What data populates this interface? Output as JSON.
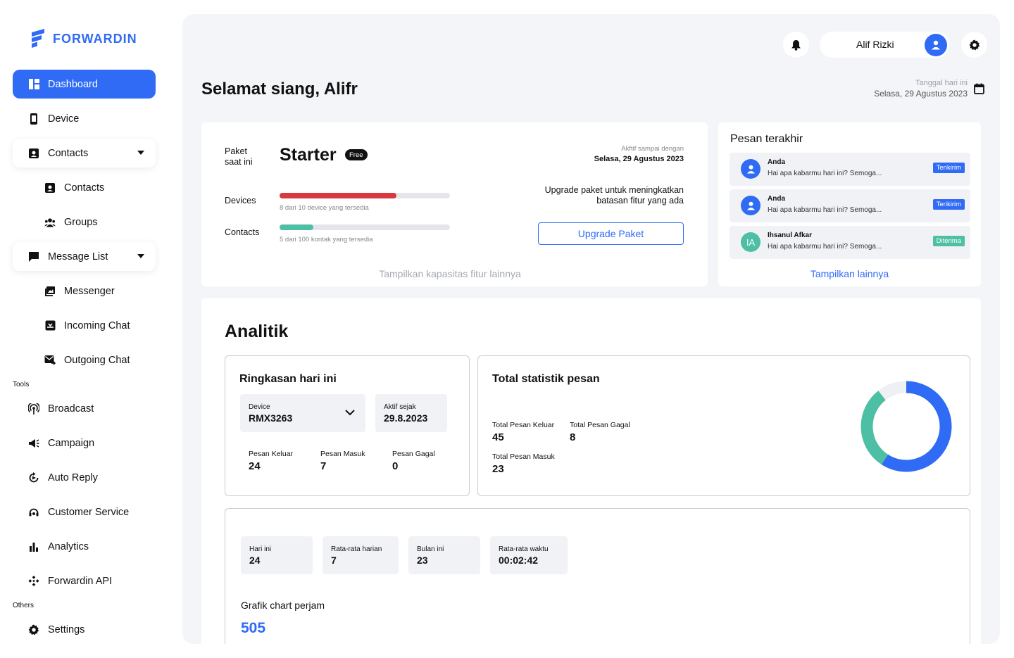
{
  "brand": {
    "name": "FORWARDIN",
    "color": "#2f6bf5"
  },
  "sidebar": {
    "items": [
      {
        "label": "Dashboard",
        "icon": "dashboard-icon"
      },
      {
        "label": "Device",
        "icon": "phone-icon"
      },
      {
        "label": "Contacts",
        "icon": "contact-card-icon"
      },
      {
        "label": "Contacts",
        "icon": "contact-card-icon"
      },
      {
        "label": "Groups",
        "icon": "groups-icon"
      },
      {
        "label": "Message List",
        "icon": "message-icon"
      },
      {
        "label": "Messenger",
        "icon": "messenger-icon"
      },
      {
        "label": "Incoming Chat",
        "icon": "inbox-icon"
      },
      {
        "label": "Outgoing Chat",
        "icon": "outbox-icon"
      },
      {
        "label": "Broadcast",
        "icon": "broadcast-icon"
      },
      {
        "label": "Campaign",
        "icon": "megaphone-icon"
      },
      {
        "label": "Auto Reply",
        "icon": "auto-reply-icon"
      },
      {
        "label": "Customer Service",
        "icon": "headset-icon"
      },
      {
        "label": "Analytics",
        "icon": "bar-chart-icon"
      },
      {
        "label": "Forwardin API",
        "icon": "api-icon"
      },
      {
        "label": "Settings",
        "icon": "gear-icon"
      }
    ],
    "section_tools": "Tools",
    "section_others": "Others"
  },
  "header": {
    "user_name": "Alif Rizki"
  },
  "greeting": "Selamat siang, Alifr",
  "date": {
    "label": "Tanggal hari ini",
    "value": "Selasa, 29 Agustus 2023"
  },
  "paket": {
    "label": "Paket saat ini",
    "plan": "Starter",
    "badge": "Free",
    "active_label": "Akftif sampai dengan",
    "active_date": "Selasa, 29 Agustus 2023",
    "devices_label": "Devices",
    "devices_hint": "8 dari 10 device yang tersedia",
    "devices_used": 8,
    "devices_total": 10,
    "contacts_label": "Contacts",
    "contacts_hint": "5 dari 100 kontak yang tersedia",
    "contacts_used": 5,
    "contacts_total": 100,
    "upgrade_text": "Upgrade paket untuk meningkatkan batasan fitur yang ada",
    "upgrade_button": "Upgrade Paket",
    "more_link": "Tampilkan kapasitas fitur lainnya",
    "devices_color": "#d7393f",
    "contacts_color": "#4dbfa4"
  },
  "messages": {
    "title": "Pesan terakhir",
    "items": [
      {
        "name": "Anda",
        "text": "Hai apa kabarmu hari ini? Semoga...",
        "status": "Terikirim",
        "status_color": "#2f6bf5",
        "avatar": "user-icon",
        "avatar_color": "#2f6bf5",
        "initials": ""
      },
      {
        "name": "Anda",
        "text": "Hai apa kabarmu hari ini? Semoga...",
        "status": "Terikirim",
        "status_color": "#2f6bf5",
        "avatar": "user-icon",
        "avatar_color": "#2f6bf5",
        "initials": ""
      },
      {
        "name": "Ihsanul Afkar",
        "text": "Hai apa kabarmu hari ini? Semoga...",
        "status": "Diterima",
        "status_color": "#4dbfa4",
        "avatar": "initials",
        "avatar_color": "#4dbfa4",
        "initials": "IA"
      }
    ],
    "more_link": "Tampilkan lainnya"
  },
  "analytics": {
    "title": "Analitik",
    "summary": {
      "title": "Ringkasan hari ini",
      "device_label": "Device",
      "device_value": "RMX3263",
      "active_label": "Aktif sejak",
      "active_value": "29.8.2023",
      "stats": [
        {
          "label": "Pesan Keluar",
          "value": "24"
        },
        {
          "label": "Pesan Masuk",
          "value": "7"
        },
        {
          "label": "Pesan Gagal",
          "value": "0"
        }
      ]
    },
    "totals": {
      "title": "Total statistik pesan",
      "keluar_label": "Total Pesan Keluar",
      "keluar_value": "45",
      "gagal_label": "Total Pesan Gagal",
      "gagal_value": "8",
      "masuk_label": "Total Pesan Masuk",
      "masuk_value": "23"
    },
    "chips": [
      {
        "label": "Hari ini",
        "value": "24"
      },
      {
        "label": "Rata-rata harian",
        "value": "7"
      },
      {
        "label": "Bulan ini",
        "value": "23"
      },
      {
        "label": "Rata-rata waktu",
        "value": "00:02:42"
      }
    ],
    "chart_title": "Grafik chart perjam",
    "chart_total": "505"
  },
  "chart_data": {
    "type": "pie",
    "donut": true,
    "categories": [
      "Total Pesan Keluar",
      "Total Pesan Masuk",
      "Total Pesan Gagal"
    ],
    "values": [
      45,
      23,
      8
    ],
    "colors": [
      "#2f6bf5",
      "#4dbfa4",
      "#eff0f4"
    ]
  }
}
